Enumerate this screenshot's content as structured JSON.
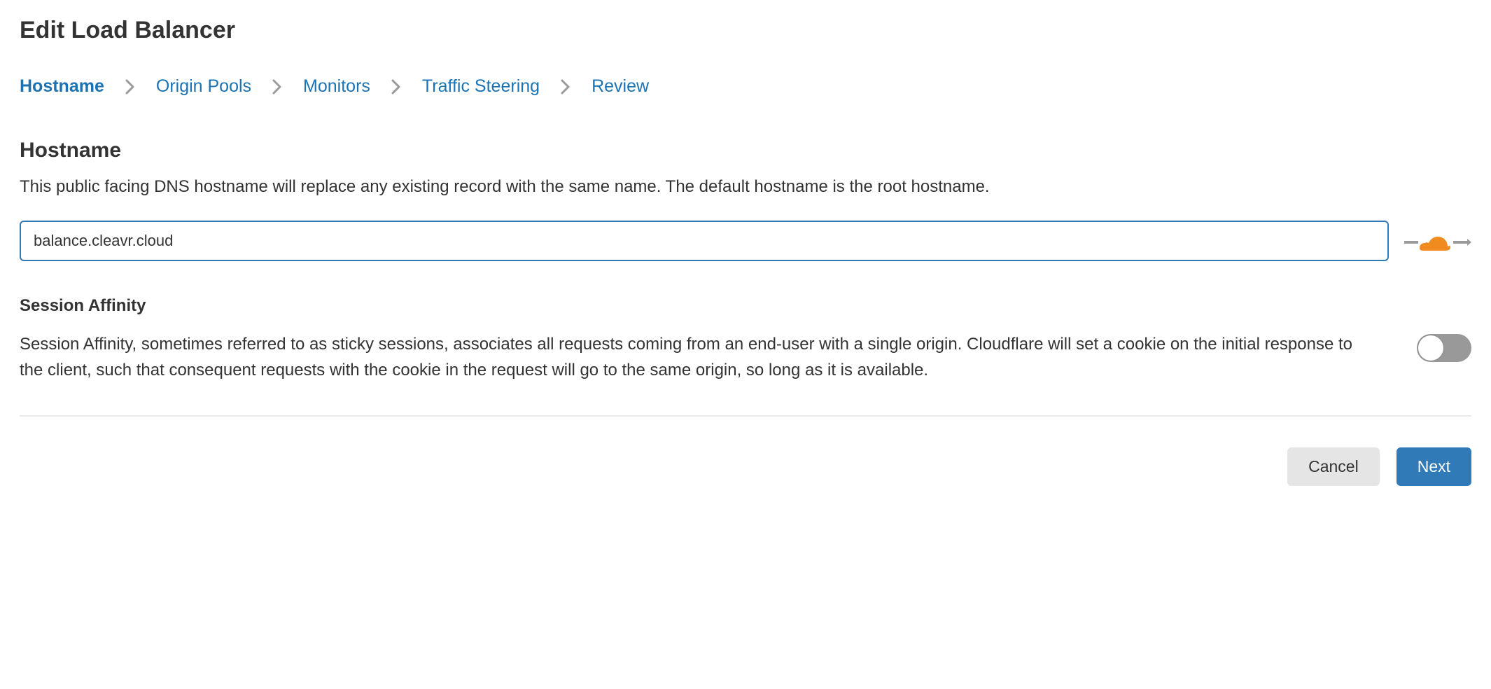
{
  "page": {
    "title": "Edit Load Balancer"
  },
  "breadcrumb": {
    "steps": [
      "Hostname",
      "Origin Pools",
      "Monitors",
      "Traffic Steering",
      "Review"
    ],
    "activeIndex": 0
  },
  "hostnameSection": {
    "title": "Hostname",
    "description": "This public facing DNS hostname will replace any existing record with the same name. The default hostname is the root hostname.",
    "inputValue": "balance.cleavr.cloud",
    "proxyIcon": "cloudflare-proxy-icon"
  },
  "sessionAffinity": {
    "title": "Session Affinity",
    "description": "Session Affinity, sometimes referred to as sticky sessions, associates all requests coming from an end-user with a single origin. Cloudflare will set a cookie on the initial response to the client, such that consequent requests with the cookie in the request will go to the same origin, so long as it is available.",
    "enabled": false
  },
  "footer": {
    "cancel": "Cancel",
    "next": "Next"
  },
  "colors": {
    "link": "#1b73b3",
    "primary": "#2f7ab7",
    "cloud": "#f08b1f"
  }
}
